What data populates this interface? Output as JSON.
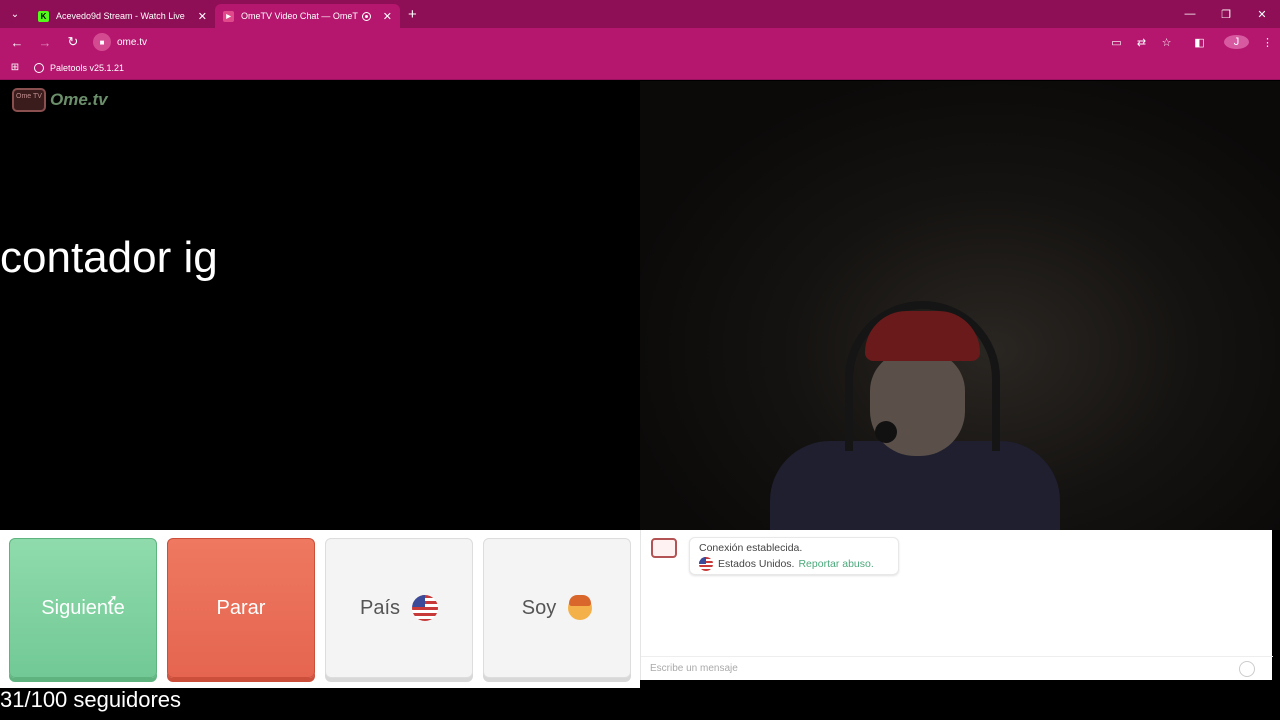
{
  "browser": {
    "tabs": [
      {
        "title": "Acevedo9d Stream - Watch Live",
        "favicon": "K",
        "active": false
      },
      {
        "title": "OmeTV Video Chat — OmeTV",
        "favicon": "▶",
        "active": true
      }
    ],
    "url": "ome.tv",
    "bookmark": "Paletools v25.1.21",
    "avatar_letter": "J"
  },
  "page": {
    "logo_tv_text": "Ome TV",
    "logo_text": "Ome.tv",
    "overlay_text": "contador ig",
    "followers_text": "31/100 seguidores"
  },
  "controls": {
    "next_label": "Siguiente",
    "stop_label": "Parar",
    "country_label": "País",
    "gender_label": "Soy"
  },
  "chat": {
    "status": "Conexión establecida.",
    "country": "Estados Unidos.",
    "report_link": "Reportar abuso.",
    "input_placeholder": "Escribe un mensaje"
  },
  "colors": {
    "tabbar": "#8e0f55",
    "toolbar": "#b5166e",
    "next_button": "#7fd3a0",
    "stop_button": "#e96c56"
  }
}
